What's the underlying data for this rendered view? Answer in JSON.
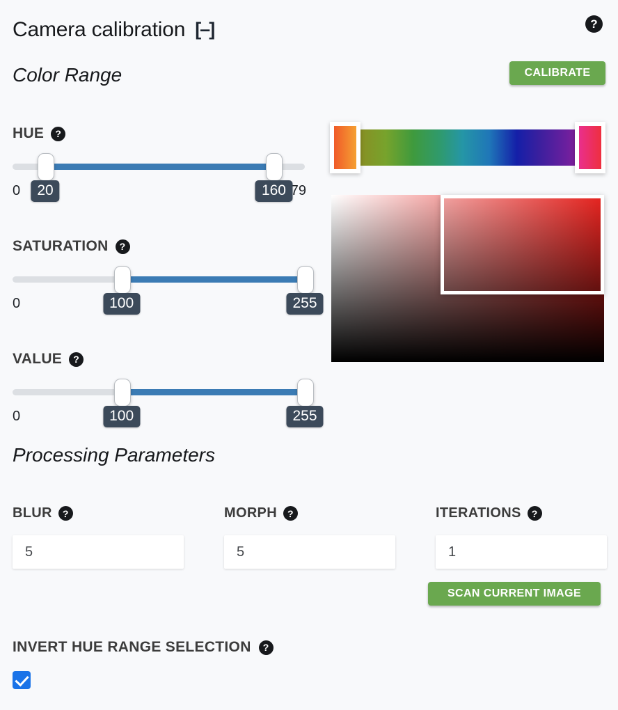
{
  "header": {
    "title": "Camera calibration",
    "collapse_icon": "[–]",
    "help_icon": "?"
  },
  "sections": {
    "color_range": "Color Range",
    "processing": "Processing Parameters"
  },
  "actions": {
    "calibrate": "CALIBRATE",
    "scan_current_image": "SCAN CURRENT IMAGE"
  },
  "sliders": [
    {
      "key": "hue",
      "label": "HUE",
      "help_icon": "?",
      "min_label": "0",
      "max_label": "179",
      "min": 0,
      "max": 179,
      "low_value": "20",
      "high_value": "160",
      "low": 20,
      "high": 160,
      "low_pct": 11.2,
      "high_pct": 89.4
    },
    {
      "key": "saturation",
      "label": "SATURATION",
      "help_icon": "?",
      "min_label": "0",
      "max_label": "",
      "min": 0,
      "max": 255,
      "low_value": "100",
      "high_value": "255",
      "low": 100,
      "high": 255,
      "low_pct": 37.3,
      "high_pct": 100
    },
    {
      "key": "value",
      "label": "VALUE",
      "help_icon": "?",
      "min_label": "0",
      "max_label": "",
      "min": 0,
      "max": 255,
      "low_value": "100",
      "high_value": "255",
      "low": 100,
      "high": 255,
      "low_pct": 37.3,
      "high_pct": 100
    }
  ],
  "preview": {
    "hue_strip": {
      "left_swatch_from": "#f05a28",
      "left_swatch_to": "#f5a033",
      "right_swatch_from": "#ea2f8c",
      "right_swatch_to": "#ee2f3f",
      "track_bg": "#dcdcdc"
    },
    "sv_picker": {
      "hue_color": "#e8221e"
    }
  },
  "parameters": [
    {
      "key": "blur",
      "label": "BLUR",
      "help_icon": "?",
      "value": "5"
    },
    {
      "key": "morph",
      "label": "MORPH",
      "help_icon": "?",
      "value": "5"
    },
    {
      "key": "iterations",
      "label": "ITERATIONS",
      "help_icon": "?",
      "value": "1"
    }
  ],
  "invert": {
    "label": "INVERT HUE RANGE SELECTION",
    "help_icon": "?",
    "checked": true
  },
  "colors": {
    "page_bg": "#f8f9fb",
    "accent_green": "#6aa84f",
    "slider_fill": "#3b7bb4",
    "bubble_bg": "#3c4a5a",
    "checkbox_blue": "#1a73e8"
  }
}
